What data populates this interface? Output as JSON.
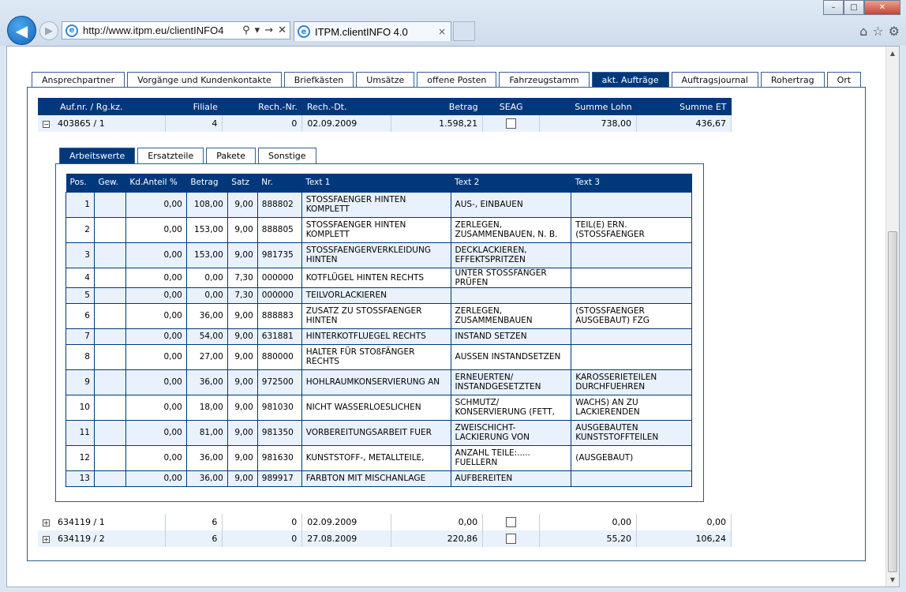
{
  "browser": {
    "address": "http://www.itpm.eu/clientINFO4",
    "tab_title": "ITPM.clientINFO 4.0",
    "tab_close": "×",
    "win_min": "–",
    "win_max": "□",
    "win_close": "✕",
    "addr_search": "⚲",
    "addr_dropdown": "▾",
    "addr_go": "→",
    "addr_stop": "✕"
  },
  "main_tabs": [
    "Ansprechpartner",
    "Vorgänge und Kundenkontakte",
    "Briefkästen",
    "Umsätze",
    "offene Posten",
    "Fahrzeugstamm",
    "akt. Aufträge",
    "Auftragsjournal",
    "Rohertrag",
    "Ort"
  ],
  "active_main_tab": "akt. Aufträge",
  "orders": {
    "headers": {
      "aufnr": "Auf.nr. / Rg.kz.",
      "filiale": "Filiale",
      "rechnr": "Rech.-Nr.",
      "rechdt": "Rech.-Dt.",
      "betrag": "Betrag",
      "seag": "SEAG",
      "lohn": "Summe Lohn",
      "et": "Summe ET"
    },
    "rows": [
      {
        "expander": "−",
        "aufnr": "403865 / 1",
        "filiale": "4",
        "rechnr": "0",
        "rechdt": "02.09.2009",
        "betrag": "1.598,21",
        "lohn": "738,00",
        "et": "436,67"
      },
      {
        "expander": "+",
        "aufnr": "634119 / 1",
        "filiale": "6",
        "rechnr": "0",
        "rechdt": "02.09.2009",
        "betrag": "0,00",
        "lohn": "0,00",
        "et": "0,00"
      },
      {
        "expander": "+",
        "aufnr": "634119 / 2",
        "filiale": "6",
        "rechnr": "0",
        "rechdt": "27.08.2009",
        "betrag": "220,86",
        "lohn": "55,20",
        "et": "106,24"
      }
    ]
  },
  "sub_tabs": [
    "Arbeitswerte",
    "Ersatzteile",
    "Pakete",
    "Sonstige"
  ],
  "active_sub_tab": "Arbeitswerte",
  "work": {
    "headers": {
      "pos": "Pos.",
      "gew": "Gew.",
      "kd": "Kd.Anteil %",
      "betrag": "Betrag",
      "satz": "Satz",
      "nr": "Nr.",
      "t1": "Text 1",
      "t2": "Text 2",
      "t3": "Text 3"
    },
    "rows": [
      {
        "pos": "1",
        "gew": "",
        "kd": "0,00",
        "betrag": "108,00",
        "satz": "9,00",
        "nr": "888802",
        "t1": "STOSSFAENGER HINTEN KOMPLETT",
        "t2": "AUS-, EINBAUEN",
        "t3": ""
      },
      {
        "pos": "2",
        "gew": "",
        "kd": "0,00",
        "betrag": "153,00",
        "satz": "9,00",
        "nr": "888805",
        "t1": "STOSSFAENGER HINTEN KOMPLETT",
        "t2": "ZERLEGEN, ZUSAMMENBAUEN, N. B.",
        "t3": "TEIL(E) ERN. (STOSSFAENGER"
      },
      {
        "pos": "3",
        "gew": "",
        "kd": "0,00",
        "betrag": "153,00",
        "satz": "9,00",
        "nr": "981735",
        "t1": "STOSSFAENGERVERKLEIDUNG HINTEN",
        "t2": "DECKLACKIEREN, EFFEKTSPRITZEN",
        "t3": ""
      },
      {
        "pos": "4",
        "gew": "",
        "kd": "0,00",
        "betrag": "0,00",
        "satz": "7,30",
        "nr": "000000",
        "t1": "KOTFLÜGEL HINTEN RECHTS",
        "t2": "UNTER STOSSFÄNGER PRÜFEN",
        "t3": ""
      },
      {
        "pos": "5",
        "gew": "",
        "kd": "0,00",
        "betrag": "0,00",
        "satz": "7,30",
        "nr": "000000",
        "t1": "TEILVORLACKIEREN",
        "t2": "",
        "t3": ""
      },
      {
        "pos": "6",
        "gew": "",
        "kd": "0,00",
        "betrag": "36,00",
        "satz": "9,00",
        "nr": "888883",
        "t1": "ZUSATZ ZU STOSSFAENGER HINTEN",
        "t2": "ZERLEGEN, ZUSAMMENBAUEN",
        "t3": "(STOSSFAENGER AUSGEBAUT) FZG"
      },
      {
        "pos": "7",
        "gew": "",
        "kd": "0,00",
        "betrag": "54,00",
        "satz": "9,00",
        "nr": "631881",
        "t1": "HINTERKOTFLUEGEL RECHTS",
        "t2": "INSTAND SETZEN",
        "t3": ""
      },
      {
        "pos": "8",
        "gew": "",
        "kd": "0,00",
        "betrag": "27,00",
        "satz": "9,00",
        "nr": "880000",
        "t1": "HALTER FÜR STOßFÄNGER RECHTS",
        "t2": "AUSSEN INSTANDSETZEN",
        "t3": ""
      },
      {
        "pos": "9",
        "gew": "",
        "kd": "0,00",
        "betrag": "36,00",
        "satz": "9,00",
        "nr": "972500",
        "t1": "HOHLRAUMKONSERVIERUNG AN",
        "t2": "ERNEUERTEN/ INSTANDGESETZTEN",
        "t3": "KAROSSERIETEILEN DURCHFUEHREN"
      },
      {
        "pos": "10",
        "gew": "",
        "kd": "0,00",
        "betrag": "18,00",
        "satz": "9,00",
        "nr": "981030",
        "t1": "NICHT WASSERLOESLICHEN",
        "t2": "SCHMUTZ/ KONSERVIERUNG (FETT,",
        "t3": "WACHS) AN ZU LACKIERENDEN"
      },
      {
        "pos": "11",
        "gew": "",
        "kd": "0,00",
        "betrag": "81,00",
        "satz": "9,00",
        "nr": "981350",
        "t1": "VORBEREITUNGSARBEIT FUER",
        "t2": "ZWEISCHICHT- LACKIERUNG VON",
        "t3": "AUSGEBAUTEN KUNSTSTOFFTEILEN"
      },
      {
        "pos": "12",
        "gew": "",
        "kd": "0,00",
        "betrag": "36,00",
        "satz": "9,00",
        "nr": "981630",
        "t1": "KUNSTSTOFF-, METALLTEILE,",
        "t2": "ANZAHL TEILE:..... FUELLERN",
        "t3": "(AUSGEBAUT)"
      },
      {
        "pos": "13",
        "gew": "",
        "kd": "0,00",
        "betrag": "36,00",
        "satz": "9,00",
        "nr": "989917",
        "t1": "FARBTON MIT MISCHANLAGE",
        "t2": "AUFBEREITEN",
        "t3": ""
      }
    ]
  }
}
